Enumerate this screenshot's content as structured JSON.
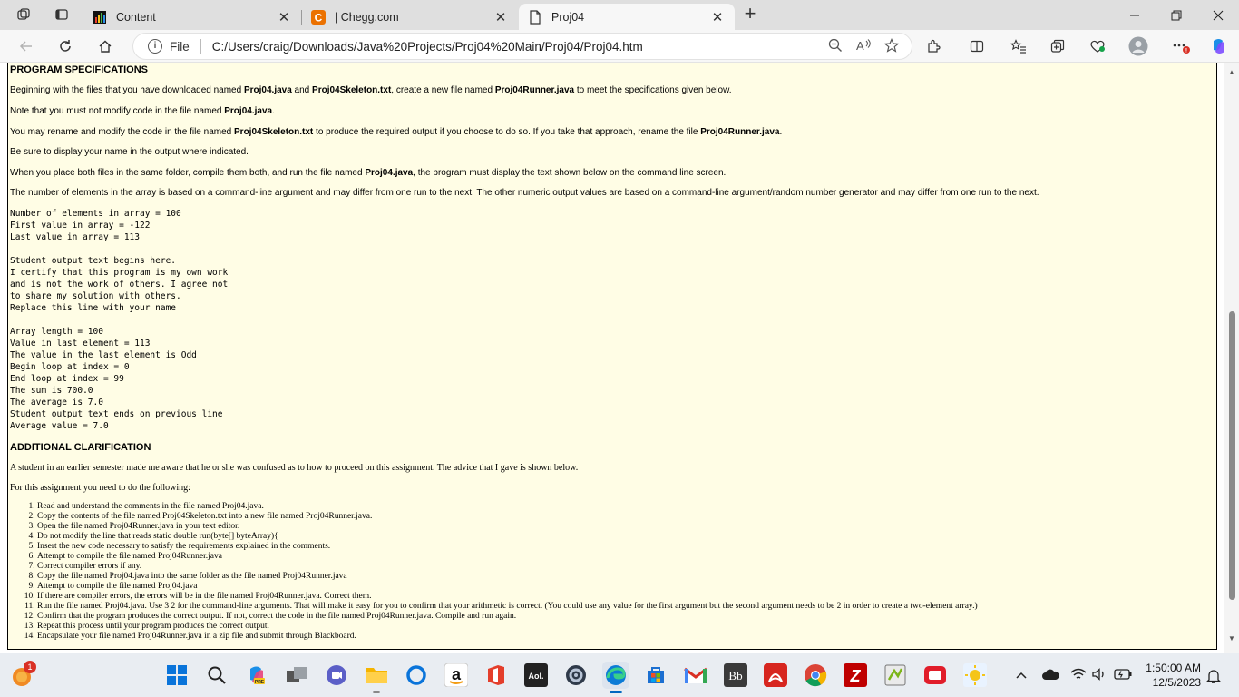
{
  "tabs": [
    {
      "title": "Content",
      "icon": "bar-chart-icon"
    },
    {
      "title": "| Chegg.com",
      "icon": "chegg-icon"
    },
    {
      "title": "Proj04",
      "icon": "document-icon"
    }
  ],
  "address": {
    "scheme_label": "File",
    "url": "C:/Users/craig/Downloads/Java%20Projects/Proj04%20Main/Proj04/Proj04.htm"
  },
  "page": {
    "spec_heading": "PROGRAM SPECIFICATIONS",
    "spec_paragraphs": [
      {
        "t1": "Beginning with the files that you have downloaded named ",
        "b1": "Proj04.java",
        "t2": " and ",
        "b2": "Proj04Skeleton.txt",
        "t3": ", create a new file named ",
        "b3": "Proj04Runner.java",
        "t4": " to meet the specifications given below."
      },
      {
        "t1": "Note that you must not modify code in the file named ",
        "b1": "Proj04.java",
        "t2": "."
      },
      {
        "t1": "You may rename and modify the code in the file named ",
        "b1": "Proj04Skeleton.txt",
        "t2": " to produce the required output if you choose to do so. If you take that approach, rename the file ",
        "b2": "Proj04Runner.java",
        "t3": "."
      },
      {
        "t1": "Be sure to display your name in the output where indicated."
      },
      {
        "t1": "When you place both files in the same folder, compile them both, and run the file named ",
        "b1": "Proj04.java",
        "t2": ", the program must display the text shown below on the command line screen."
      },
      {
        "t1": "The number of elements in the array is based on a command-line argument and may differ from one run to the next. The other numeric output values are based on a command-line argument/random number generator and may differ from one run to the next."
      }
    ],
    "output_block": "Number of elements in array = 100\nFirst value in array = -122\nLast value in array = 113\n\nStudent output text begins here.\nI certify that this program is my own work\nand is not the work of others. I agree not\nto share my solution with others.\nReplace this line with your name\n\nArray length = 100\nValue in last element = 113\nThe value in the last element is Odd\nBegin loop at index = 0\nEnd loop at index = 99\nThe sum is 700.0\nThe average is 7.0\nStudent output text ends on previous line\nAverage value = 7.0",
    "clar_heading": "ADDITIONAL CLARIFICATION",
    "clar_para1": "A student in an earlier semester made me aware that he or she was confused as to how to proceed on this assignment. The advice that I gave is shown below.",
    "clar_para2": "For this assignment you need to do the following:",
    "steps": [
      "Read and understand the comments in the file named Proj04.java.",
      "Copy the contents of the file named Proj04Skeleton.txt into a new file named Proj04Runner.java.",
      "Open the file named Proj04Runner.java in your text editor.",
      "Do not modify the line that reads static double run(byte[] byteArray){",
      "Insert the new code necessary to satisfy the requirements explained in the comments.",
      "Attempt to compile the file named Proj04Runner.java",
      "Correct compiler errors if any.",
      "Copy the file named Proj04.java into the same folder as the file named Proj04Runner.java",
      "Attempt to compile the file named Proj04.java",
      "If there are compiler errors, the errors will be in the file named Proj04Runner.java. Correct them.",
      "Run the file named Proj04.java. Use 3 2 for the command-line arguments. That will make it easy for you to confirm that your arithmetic is correct. (You could use any value for the first argument but the second argument needs to be 2 in order to create a two-element array.)",
      "Confirm that the program produces the correct output. If not, correct the code in the file named Proj04Runner.java. Compile and run again.",
      "Repeat this process until your program produces the correct output.",
      "Encapsulate your file named Proj04Runner.java in a zip file and submit through Blackboard."
    ]
  },
  "taskbar": {
    "weather_badge": "1",
    "clock_time": "1:50:00 AM",
    "clock_date": "12/5/2023"
  },
  "colors": {
    "page_bg": "#fffde5",
    "accent": "#0067c0"
  }
}
